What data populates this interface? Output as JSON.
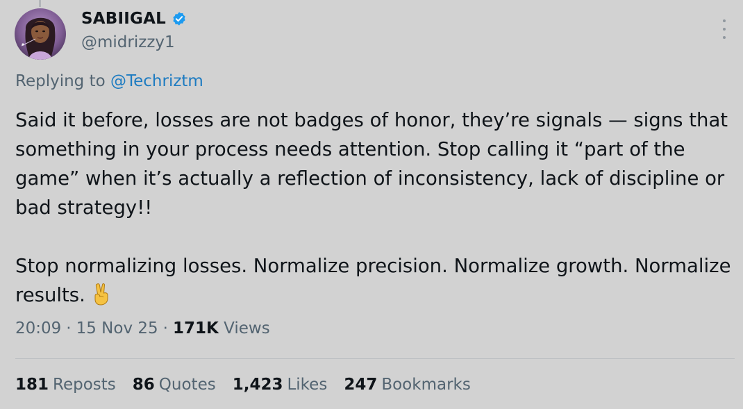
{
  "author": {
    "display_name": "SABIIGAL",
    "handle": "@midrizzy1",
    "verified": true,
    "verified_color": "#1d9bf0"
  },
  "reply": {
    "prefix": "Replying to",
    "mention": "@Techriztm"
  },
  "tweet": {
    "paragraph_1": "Said it before, losses are not badges of honor, they’re signals — signs that something in your process needs attention. Stop calling it “part of the game” when it’s actually a reflection of inconsistency, lack of discipline or bad strategy!!",
    "paragraph_2": "Stop normalizing losses. Normalize precision. Normalize growth. Normalize results.",
    "emoji": "victory-hand-icon"
  },
  "meta": {
    "time": "20:09",
    "date": "15 Nov 25",
    "views_count": "171K",
    "views_label": "Views"
  },
  "stats": {
    "reposts_count": "181",
    "reposts_label": "Reposts",
    "quotes_count": "86",
    "quotes_label": "Quotes",
    "likes_count": "1,423",
    "likes_label": "Likes",
    "bookmarks_count": "247",
    "bookmarks_label": "Bookmarks"
  },
  "colors": {
    "background": "#d2d2d2",
    "text_primary": "#0f1419",
    "text_secondary": "#536471",
    "link": "#1d7bc1"
  },
  "icons": {
    "more": "more-options-icon",
    "verified": "verified-badge-icon",
    "avatar": "avatar"
  }
}
